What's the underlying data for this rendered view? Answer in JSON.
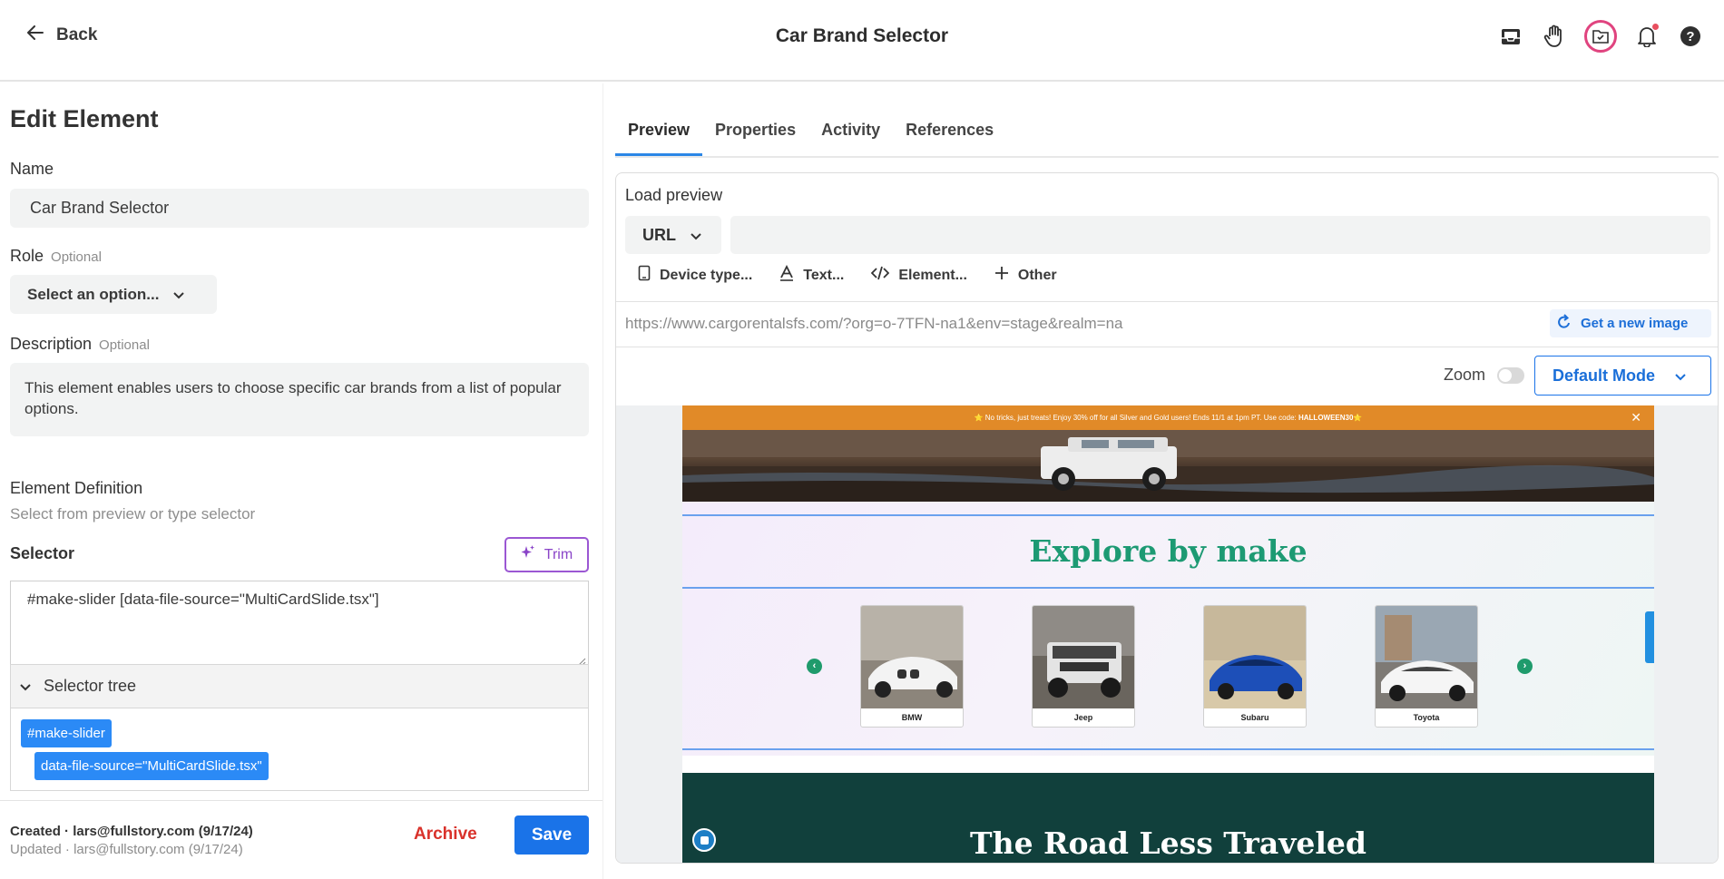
{
  "header": {
    "back_label": "Back",
    "title": "Car Brand Selector",
    "icons": [
      "inbox-icon",
      "hand-icon",
      "folder-check-icon",
      "bell-icon",
      "help-icon"
    ]
  },
  "edit": {
    "heading": "Edit Element",
    "name_label": "Name",
    "name_value": "Car Brand Selector",
    "role_label": "Role",
    "optional": "Optional",
    "role_value": "Select an option...",
    "description_label": "Description",
    "description_value": "This element enables users to choose specific car brands from a list of popular options.",
    "definition_label": "Element Definition",
    "definition_sub": "Select from preview or type selector",
    "selector_label": "Selector",
    "trim_label": "Trim",
    "selector_value": "#make-slider [data-file-source=\"MultiCardSlide.tsx\"]",
    "tree_label": "Selector tree",
    "tree_chips": [
      "#make-slider",
      "data-file-source=\"MultiCardSlide.tsx\""
    ]
  },
  "footer": {
    "created_prefix": "Created",
    "created_value": "lars@fullstory.com (9/17/24)",
    "updated_prefix": "Updated",
    "updated_value": "lars@fullstory.com (9/17/24)",
    "archive_label": "Archive",
    "save_label": "Save"
  },
  "tabs": [
    "Preview",
    "Properties",
    "Activity",
    "References"
  ],
  "preview": {
    "load_label": "Load preview",
    "url_type": "URL",
    "url_input_value": "",
    "options": [
      "Device type...",
      "Text...",
      "Element...",
      "Other"
    ],
    "url": "https://www.cargorentalsfs.com/?org=o-7TFN-na1&env=stage&realm=na",
    "get_image_label": "Get a new image",
    "zoom_label": "Zoom",
    "zoom_on": false,
    "mode_label": "Default Mode"
  },
  "site": {
    "promo_text": "⭐ No tricks, just treats! Enjoy 30% off for all Silver and Gold users! Ends 11/1 at 1pm PT. Use code: ",
    "promo_code": "HALLOWEEN30⭐",
    "promo_close": "✕",
    "explore_title": "Explore by make",
    "brands": [
      "BMW",
      "Jeep",
      "Subaru",
      "Toyota"
    ],
    "arrow_prev": "‹",
    "arrow_next": "›",
    "road_title": "The Road Less Traveled"
  },
  "colors": {
    "accent": "#1a73e8",
    "archive": "#d9322b",
    "trim": "#8a44c8",
    "explore_title": "#1d9a73",
    "road_bg": "#11403c",
    "promo_bg": "#e18a28",
    "active_icon_ring": "#e0447f"
  }
}
